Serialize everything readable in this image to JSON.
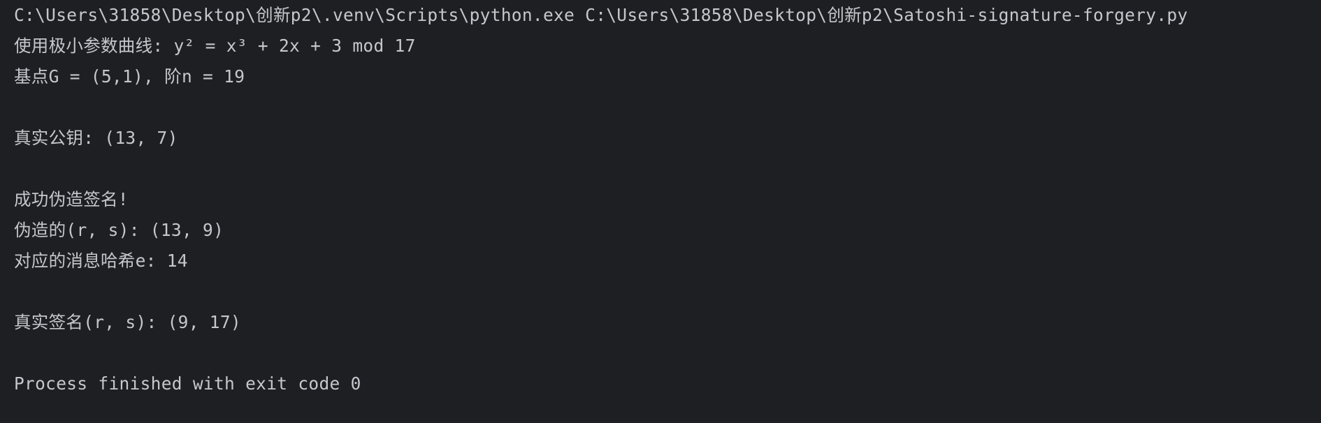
{
  "console": {
    "command": "C:\\Users\\31858\\Desktop\\创新p2\\.venv\\Scripts\\python.exe C:\\Users\\31858\\Desktop\\创新p2\\Satoshi-signature-forgery.py",
    "output": {
      "curve_line": "使用极小参数曲线: y² = x³ + 2x + 3 mod 17",
      "base_point_line": "基点G = (5,1), 阶n = 19",
      "public_key_line": "真实公钥: (13, 7)",
      "success_line": "成功伪造签名!",
      "forged_rs_line": "伪造的(r, s): (13, 9)",
      "message_hash_line": "对应的消息哈希e: 14",
      "real_signature_line": "真实签名(r, s): (9, 17)"
    },
    "exit_message": "Process finished with exit code 0"
  },
  "colors": {
    "background": "#1e1f22",
    "text": "#c5c7cc"
  }
}
